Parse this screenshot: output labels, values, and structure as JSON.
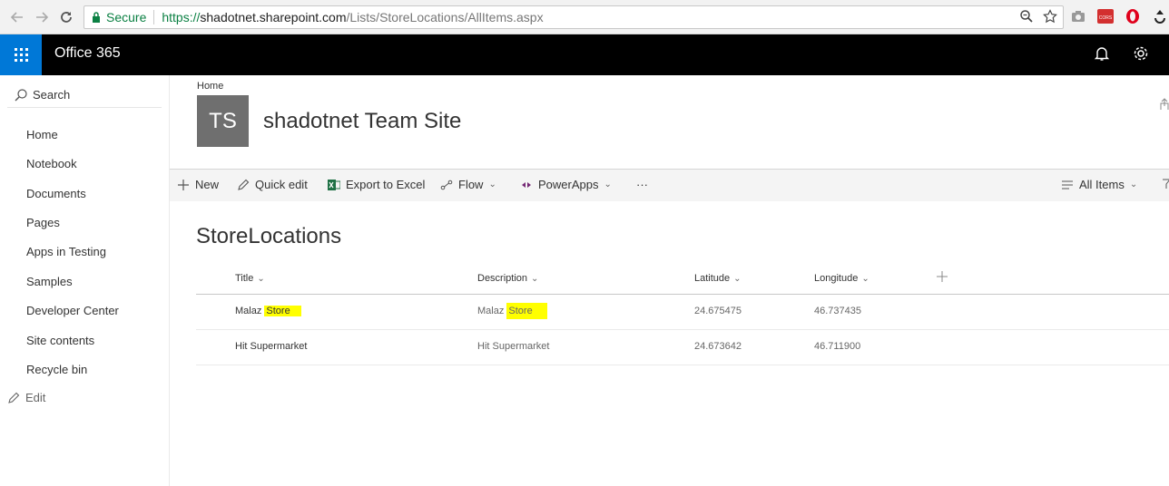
{
  "browser": {
    "secure_label": "Secure",
    "url_scheme": "https://",
    "url_host": "shadotnet.sharepoint.com",
    "url_path": "/Lists/StoreLocations/AllItems.aspx",
    "ext_cors_label": "CORS"
  },
  "suite": {
    "title": "Office 365",
    "accent": "#0078d7"
  },
  "leftnav": {
    "search_label": "Search",
    "items": [
      {
        "label": "Home"
      },
      {
        "label": "Notebook"
      },
      {
        "label": "Documents"
      },
      {
        "label": "Pages"
      },
      {
        "label": "Apps in Testing"
      },
      {
        "label": "Samples"
      },
      {
        "label": "Developer Center"
      },
      {
        "label": "Site contents"
      },
      {
        "label": "Recycle bin"
      }
    ],
    "edit_label": "Edit"
  },
  "site": {
    "breadcrumb": "Home",
    "logo_initials": "TS",
    "title": "shadotnet Team Site"
  },
  "commands": {
    "new": "New",
    "quick_edit": "Quick edit",
    "export": "Export to Excel",
    "flow": "Flow",
    "powerapps": "PowerApps",
    "more": "···",
    "view": "All Items"
  },
  "list": {
    "title": "StoreLocations",
    "columns": [
      "Title",
      "Description",
      "Latitude",
      "Longitude"
    ],
    "rows": [
      {
        "title_prefix": "Malaz ",
        "title_hl": "Store",
        "desc_prefix": "Malaz ",
        "desc_hl": "Store",
        "latitude": "24.675475",
        "longitude": "46.737435"
      },
      {
        "title_prefix": "Hit Supermarket",
        "title_hl": "",
        "desc_prefix": "Hit Supermarket",
        "desc_hl": "",
        "latitude": "24.673642",
        "longitude": "46.711900"
      }
    ],
    "highlight_color": "#ffff00"
  }
}
